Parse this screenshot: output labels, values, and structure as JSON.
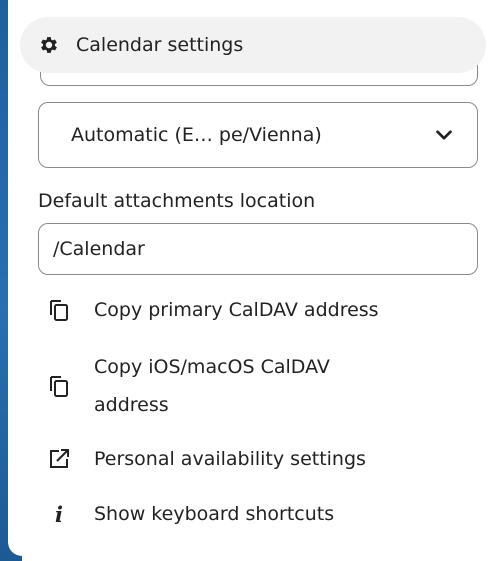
{
  "header": {
    "title": "Calendar settings",
    "icon": "gear-icon"
  },
  "timezone_select": {
    "value": "Automatic (E… pe/Vienna)",
    "icon": "chevron-down-icon"
  },
  "attachments": {
    "label": "Default attachments location",
    "value": "/Calendar"
  },
  "actions": [
    {
      "label": "Copy primary CalDAV address",
      "icon": "copy-icon"
    },
    {
      "label_line1": "Copy iOS/macOS CalDAV",
      "label_line2": "address",
      "icon": "copy-icon"
    },
    {
      "label": "Personal availability settings",
      "icon": "external-link-icon"
    },
    {
      "label": "Show keyboard shortcuts",
      "icon": "info-icon",
      "glyph": "i"
    }
  ],
  "colors": {
    "accent_blue": "#2a6fb0",
    "border": "#8a8a8a",
    "pill_bg": "#f2f2f2"
  }
}
